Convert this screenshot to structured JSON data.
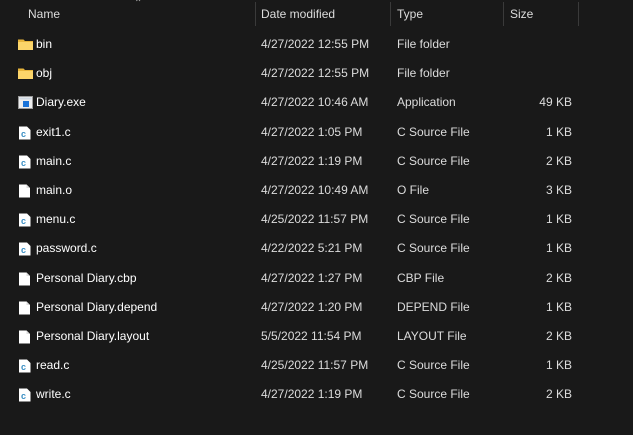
{
  "columns": {
    "name": "Name",
    "date": "Date modified",
    "type": "Type",
    "size": "Size"
  },
  "files": [
    {
      "name": "bin",
      "date": "4/27/2022 12:55 PM",
      "type": "File folder",
      "size": "",
      "icon": "folder"
    },
    {
      "name": "obj",
      "date": "4/27/2022 12:55 PM",
      "type": "File folder",
      "size": "",
      "icon": "folder"
    },
    {
      "name": "Diary.exe",
      "date": "4/27/2022 10:46 AM",
      "type": "Application",
      "size": "49 KB",
      "icon": "app"
    },
    {
      "name": "exit1.c",
      "date": "4/27/2022 1:05 PM",
      "type": "C Source File",
      "size": "1 KB",
      "icon": "c"
    },
    {
      "name": "main.c",
      "date": "4/27/2022 1:19 PM",
      "type": "C Source File",
      "size": "2 KB",
      "icon": "c"
    },
    {
      "name": "main.o",
      "date": "4/27/2022 10:49 AM",
      "type": "O File",
      "size": "3 KB",
      "icon": "file"
    },
    {
      "name": "menu.c",
      "date": "4/25/2022 11:57 PM",
      "type": "C Source File",
      "size": "1 KB",
      "icon": "c"
    },
    {
      "name": "password.c",
      "date": "4/22/2022 5:21 PM",
      "type": "C Source File",
      "size": "1 KB",
      "icon": "c"
    },
    {
      "name": "Personal Diary.cbp",
      "date": "4/27/2022 1:27 PM",
      "type": "CBP File",
      "size": "2 KB",
      "icon": "file"
    },
    {
      "name": "Personal Diary.depend",
      "date": "4/27/2022 1:20 PM",
      "type": "DEPEND File",
      "size": "1 KB",
      "icon": "file"
    },
    {
      "name": "Personal Diary.layout",
      "date": "5/5/2022 11:54 PM",
      "type": "LAYOUT File",
      "size": "2 KB",
      "icon": "file"
    },
    {
      "name": "read.c",
      "date": "4/25/2022 11:57 PM",
      "type": "C Source File",
      "size": "1 KB",
      "icon": "c"
    },
    {
      "name": "write.c",
      "date": "4/27/2022 1:19 PM",
      "type": "C Source File",
      "size": "2 KB",
      "icon": "c"
    }
  ]
}
